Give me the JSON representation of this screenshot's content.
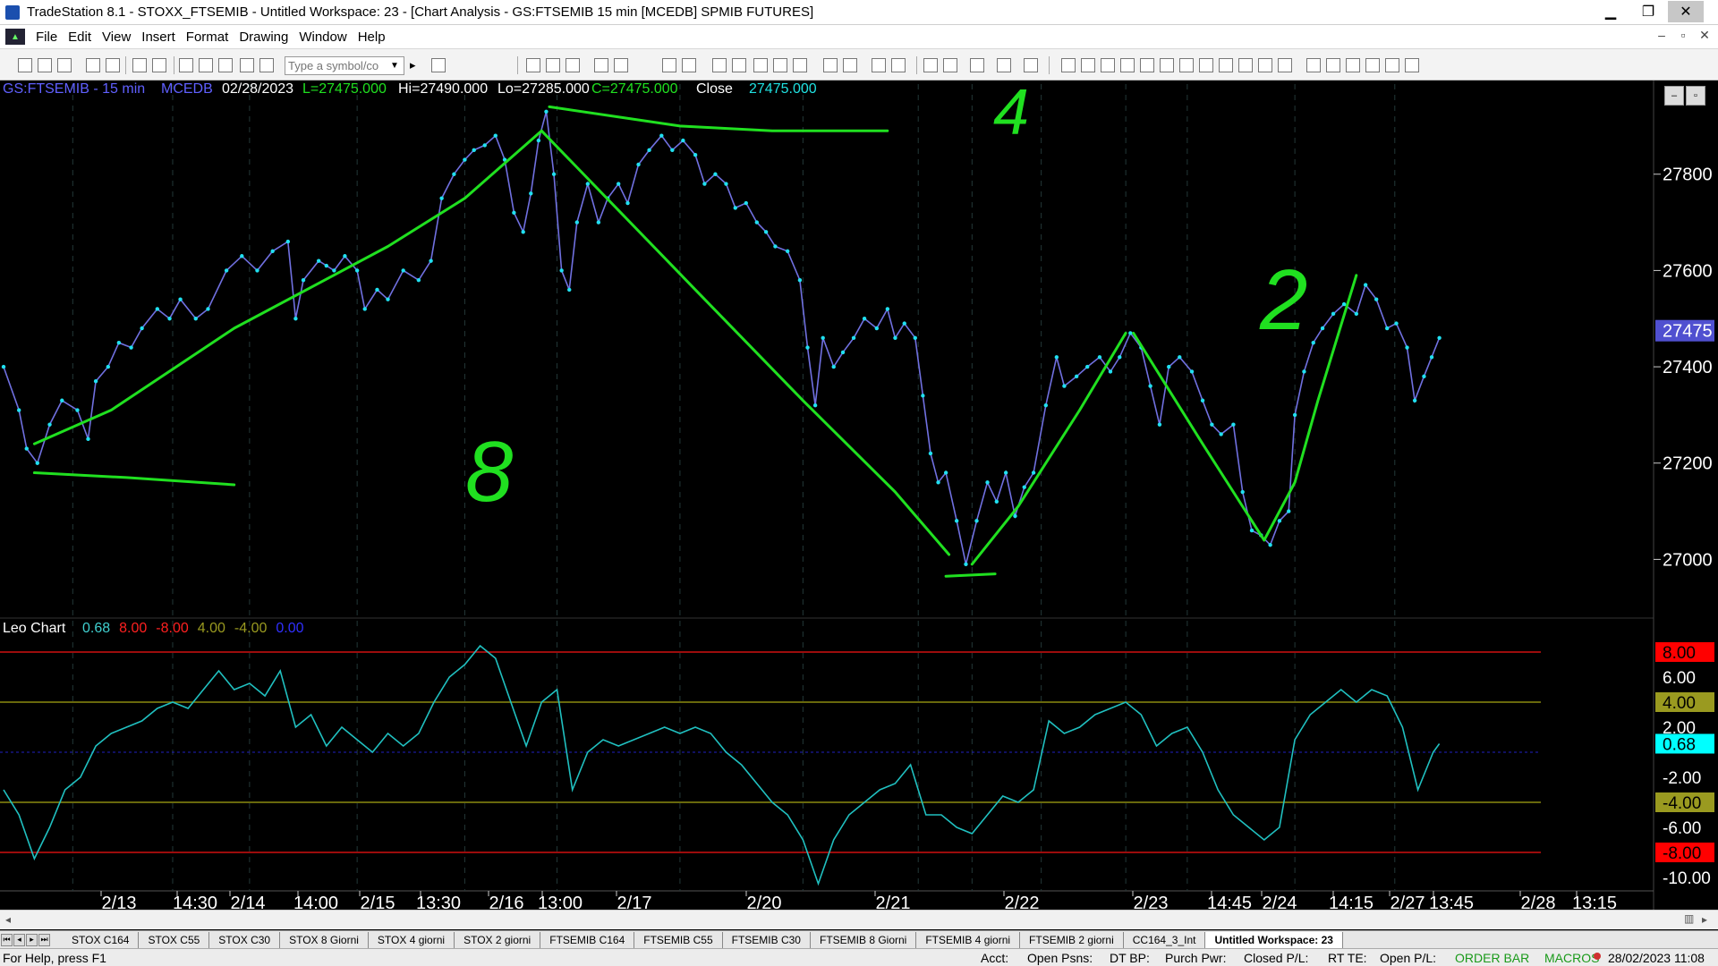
{
  "window": {
    "title": "TradeStation 8.1 - STOXX_FTSEMIB - Untitled Workspace:  23 - [Chart Analysis - GS:FTSEMIB  15 min  [MCEDB] SPMIB FUTURES]",
    "minimize": "▁",
    "restore": "❐",
    "close": "✕"
  },
  "menu": {
    "items": [
      "File",
      "Edit",
      "View",
      "Insert",
      "Format",
      "Drawing",
      "Window",
      "Help"
    ],
    "mdi_min": "–",
    "mdi_restore": "▫",
    "mdi_close": "✕"
  },
  "toolbar": {
    "symbol_placeholder": "Type a symbol/co",
    "dropdown": "▼",
    "arrow": "▸"
  },
  "chart_header": {
    "symbol": "GS:FTSEMIB - 15 min",
    "source": "MCEDB",
    "date": "02/28/2023",
    "last": "L=27475.000",
    "high": "Hi=27490.000",
    "low": "Lo=27285.000",
    "close": "C=27475.000",
    "close_label": "Close",
    "close_value": "27475.000"
  },
  "indicator_header": {
    "name": "Leo Chart",
    "values": [
      {
        "text": "0.68",
        "color": "#40d0d0"
      },
      {
        "text": "8.00",
        "color": "#ff2020"
      },
      {
        "text": "-8.00",
        "color": "#ff2020"
      },
      {
        "text": "4.00",
        "color": "#9a9a20"
      },
      {
        "text": "-4.00",
        "color": "#9a9a20"
      },
      {
        "text": "0.00",
        "color": "#3030ff"
      }
    ]
  },
  "price_axis": {
    "labels": [
      "27800",
      "27600",
      "27400",
      "27200",
      "27000"
    ],
    "current": "27475"
  },
  "indicator_axis": {
    "labels": [
      "8.00",
      "6.00",
      "4.00",
      "2.00",
      "0.68",
      "-2.00",
      "-4.00",
      "-6.00",
      "-8.00",
      "-10.00"
    ],
    "highlight": {
      "8.00": "#ff0000",
      "4.00": "#9a9a20",
      "0.68": "#00ffff",
      "-4.00": "#9a9a20",
      "-8.00": "#ff0000"
    }
  },
  "time_axis": {
    "labels": [
      "2/13",
      "14:30",
      "2/14",
      "14:00",
      "2/15",
      "13:30",
      "2/16",
      "13:00",
      "2/17",
      "2/20",
      "2/21",
      "2/22",
      "2/23",
      "14:45",
      "2/24",
      "14:15",
      "2/27",
      "13:45",
      "2/28",
      "13:15"
    ]
  },
  "annotations": {
    "handwritten": [
      "4",
      "2",
      "8"
    ]
  },
  "chart_data": {
    "type": "line",
    "title": "GS:FTSEMIB - 15 min",
    "ylim": [
      26880,
      27950
    ],
    "x_range": [
      0,
      100
    ],
    "price": [
      [
        0,
        27400
      ],
      [
        1,
        27310
      ],
      [
        1.5,
        27230
      ],
      [
        2.2,
        27200
      ],
      [
        3,
        27280
      ],
      [
        3.8,
        27330
      ],
      [
        4.8,
        27310
      ],
      [
        5.5,
        27250
      ],
      [
        6,
        27370
      ],
      [
        6.8,
        27400
      ],
      [
        7.5,
        27450
      ],
      [
        8.3,
        27440
      ],
      [
        9,
        27480
      ],
      [
        10,
        27520
      ],
      [
        10.8,
        27500
      ],
      [
        11.5,
        27540
      ],
      [
        12.5,
        27500
      ],
      [
        13.3,
        27520
      ],
      [
        14.5,
        27600
      ],
      [
        15.5,
        27630
      ],
      [
        16.5,
        27600
      ],
      [
        17.5,
        27640
      ],
      [
        18.5,
        27660
      ],
      [
        19,
        27500
      ],
      [
        19.5,
        27580
      ],
      [
        20.5,
        27620
      ],
      [
        21,
        27610
      ],
      [
        21.5,
        27600
      ],
      [
        22.2,
        27630
      ],
      [
        23,
        27600
      ],
      [
        23.5,
        27520
      ],
      [
        24.3,
        27560
      ],
      [
        25,
        27540
      ],
      [
        26,
        27600
      ],
      [
        27,
        27580
      ],
      [
        27.8,
        27620
      ],
      [
        28.5,
        27750
      ],
      [
        29.3,
        27800
      ],
      [
        30,
        27830
      ],
      [
        30.6,
        27850
      ],
      [
        31.3,
        27860
      ],
      [
        32,
        27880
      ],
      [
        32.6,
        27830
      ],
      [
        33.2,
        27720
      ],
      [
        33.8,
        27680
      ],
      [
        34.3,
        27760
      ],
      [
        34.8,
        27870
      ],
      [
        35.3,
        27930
      ],
      [
        35.8,
        27800
      ],
      [
        36.3,
        27600
      ],
      [
        36.8,
        27560
      ],
      [
        37.3,
        27700
      ],
      [
        38,
        27780
      ],
      [
        38.7,
        27700
      ],
      [
        39.3,
        27750
      ],
      [
        40,
        27780
      ],
      [
        40.6,
        27740
      ],
      [
        41.3,
        27820
      ],
      [
        42,
        27850
      ],
      [
        42.8,
        27880
      ],
      [
        43.5,
        27850
      ],
      [
        44.2,
        27870
      ],
      [
        45,
        27840
      ],
      [
        45.6,
        27780
      ],
      [
        46.3,
        27800
      ],
      [
        47,
        27780
      ],
      [
        47.6,
        27730
      ],
      [
        48.3,
        27740
      ],
      [
        49,
        27700
      ],
      [
        49.6,
        27680
      ],
      [
        50.2,
        27650
      ],
      [
        51,
        27640
      ],
      [
        51.8,
        27580
      ],
      [
        52.3,
        27440
      ],
      [
        52.8,
        27320
      ],
      [
        53.3,
        27460
      ],
      [
        54,
        27400
      ],
      [
        54.6,
        27430
      ],
      [
        55.3,
        27460
      ],
      [
        56,
        27500
      ],
      [
        56.8,
        27480
      ],
      [
        57.5,
        27520
      ],
      [
        58,
        27460
      ],
      [
        58.6,
        27490
      ],
      [
        59.3,
        27460
      ],
      [
        59.8,
        27340
      ],
      [
        60.3,
        27220
      ],
      [
        60.8,
        27160
      ],
      [
        61.3,
        27180
      ],
      [
        62,
        27080
      ],
      [
        62.6,
        26990
      ],
      [
        63.3,
        27080
      ],
      [
        64,
        27160
      ],
      [
        64.6,
        27120
      ],
      [
        65.2,
        27180
      ],
      [
        65.8,
        27090
      ],
      [
        66.4,
        27150
      ],
      [
        67,
        27180
      ],
      [
        67.8,
        27320
      ],
      [
        68.5,
        27420
      ],
      [
        69,
        27360
      ],
      [
        69.8,
        27380
      ],
      [
        70.5,
        27400
      ],
      [
        71.3,
        27420
      ],
      [
        72,
        27390
      ],
      [
        72.6,
        27420
      ],
      [
        73.3,
        27470
      ],
      [
        74,
        27440
      ],
      [
        74.6,
        27360
      ],
      [
        75.2,
        27280
      ],
      [
        75.8,
        27400
      ],
      [
        76.5,
        27420
      ],
      [
        77.3,
        27390
      ],
      [
        78,
        27330
      ],
      [
        78.6,
        27280
      ],
      [
        79.2,
        27260
      ],
      [
        80,
        27280
      ],
      [
        80.6,
        27140
      ],
      [
        81.2,
        27060
      ],
      [
        81.8,
        27050
      ],
      [
        82.4,
        27030
      ],
      [
        83,
        27080
      ],
      [
        83.6,
        27100
      ],
      [
        84,
        27300
      ],
      [
        84.6,
        27390
      ],
      [
        85.2,
        27450
      ],
      [
        85.8,
        27480
      ],
      [
        86.5,
        27510
      ],
      [
        87.2,
        27530
      ],
      [
        88,
        27510
      ],
      [
        88.6,
        27570
      ],
      [
        89.3,
        27540
      ],
      [
        90,
        27480
      ],
      [
        90.6,
        27490
      ],
      [
        91.3,
        27440
      ],
      [
        91.8,
        27330
      ],
      [
        92.4,
        27380
      ],
      [
        92.9,
        27420
      ],
      [
        93.4,
        27460
      ]
    ],
    "drawn_lines": [
      {
        "name": "trend-up-1",
        "points": [
          [
            2,
            27240
          ],
          [
            7,
            27310
          ],
          [
            15,
            27480
          ],
          [
            25,
            27650
          ],
          [
            30,
            27750
          ],
          [
            35,
            27890
          ]
        ]
      },
      {
        "name": "trend-down-1",
        "points": [
          [
            35,
            27890
          ],
          [
            45,
            27560
          ],
          [
            52,
            27330
          ],
          [
            58,
            27140
          ],
          [
            61.5,
            27010
          ]
        ]
      },
      {
        "name": "trend-up-2",
        "points": [
          [
            63,
            26990
          ],
          [
            66,
            27110
          ],
          [
            70,
            27310
          ],
          [
            73,
            27470
          ]
        ]
      },
      {
        "name": "trend-down-2",
        "points": [
          [
            73.5,
            27470
          ],
          [
            78,
            27240
          ],
          [
            82,
            27040
          ]
        ]
      },
      {
        "name": "trend-up-3",
        "points": [
          [
            82,
            27040
          ],
          [
            84,
            27160
          ],
          [
            85.5,
            27330
          ],
          [
            88,
            27590
          ]
        ]
      },
      {
        "name": "top-line",
        "points": [
          [
            35.5,
            27940
          ],
          [
            44,
            27900
          ],
          [
            50,
            27890
          ],
          [
            57.5,
            27890
          ]
        ]
      },
      {
        "name": "low-line-left",
        "points": [
          [
            2,
            27180
          ],
          [
            8,
            27170
          ],
          [
            15,
            27155
          ]
        ]
      },
      {
        "name": "low-line-right",
        "points": [
          [
            61.3,
            26965
          ],
          [
            64.5,
            26970
          ]
        ]
      }
    ],
    "indicator": {
      "name": "Leo Chart",
      "ylim": [
        -11,
        9.5
      ],
      "levels": [
        8,
        4,
        0,
        -4,
        -8
      ],
      "values": [
        [
          0,
          -3
        ],
        [
          1,
          -5
        ],
        [
          2,
          -8.5
        ],
        [
          3,
          -6
        ],
        [
          4,
          -3
        ],
        [
          5,
          -2
        ],
        [
          6,
          0.5
        ],
        [
          7,
          1.5
        ],
        [
          8,
          2
        ],
        [
          9,
          2.5
        ],
        [
          10,
          3.5
        ],
        [
          11,
          4
        ],
        [
          12,
          3.5
        ],
        [
          13,
          5
        ],
        [
          14,
          6.5
        ],
        [
          15,
          5
        ],
        [
          16,
          5.5
        ],
        [
          17,
          4.5
        ],
        [
          18,
          6.5
        ],
        [
          19,
          2
        ],
        [
          20,
          3
        ],
        [
          21,
          0.5
        ],
        [
          22,
          2
        ],
        [
          23,
          1
        ],
        [
          24,
          0
        ],
        [
          25,
          1.5
        ],
        [
          26,
          0.5
        ],
        [
          27,
          1.5
        ],
        [
          28,
          4
        ],
        [
          29,
          6
        ],
        [
          30,
          7
        ],
        [
          31,
          8.5
        ],
        [
          32,
          7.5
        ],
        [
          33,
          4
        ],
        [
          34,
          0.5
        ],
        [
          35,
          4
        ],
        [
          36,
          5
        ],
        [
          37,
          -3
        ],
        [
          38,
          0
        ],
        [
          39,
          1
        ],
        [
          40,
          0.5
        ],
        [
          41,
          1
        ],
        [
          42,
          1.5
        ],
        [
          43,
          2
        ],
        [
          44,
          1.5
        ],
        [
          45,
          2
        ],
        [
          46,
          1.5
        ],
        [
          47,
          0
        ],
        [
          48,
          -1
        ],
        [
          49,
          -2.5
        ],
        [
          50,
          -4
        ],
        [
          51,
          -5
        ],
        [
          52,
          -7
        ],
        [
          53,
          -10.5
        ],
        [
          54,
          -7
        ],
        [
          55,
          -5
        ],
        [
          56,
          -4
        ],
        [
          57,
          -3
        ],
        [
          58,
          -2.5
        ],
        [
          59,
          -1
        ],
        [
          60,
          -5
        ],
        [
          61,
          -5
        ],
        [
          62,
          -6
        ],
        [
          63,
          -6.5
        ],
        [
          64,
          -5
        ],
        [
          65,
          -3.5
        ],
        [
          66,
          -4
        ],
        [
          67,
          -3
        ],
        [
          68,
          2.5
        ],
        [
          69,
          1.5
        ],
        [
          70,
          2
        ],
        [
          71,
          3
        ],
        [
          72,
          3.5
        ],
        [
          73,
          4
        ],
        [
          74,
          3
        ],
        [
          75,
          0.5
        ],
        [
          76,
          1.5
        ],
        [
          77,
          2
        ],
        [
          78,
          0
        ],
        [
          79,
          -3
        ],
        [
          80,
          -5
        ],
        [
          81,
          -6
        ],
        [
          82,
          -7
        ],
        [
          83,
          -6
        ],
        [
          84,
          1
        ],
        [
          85,
          3
        ],
        [
          86,
          4
        ],
        [
          87,
          5
        ],
        [
          88,
          4
        ],
        [
          89,
          5
        ],
        [
          90,
          4.5
        ],
        [
          91,
          2
        ],
        [
          92,
          -3
        ],
        [
          93,
          0
        ],
        [
          93.4,
          0.68
        ]
      ]
    },
    "colors": {
      "price_line": "#7070e0",
      "price_dots": "#20e0f0",
      "drawn_lines": "#20e020",
      "indicator_line": "#20c0c0"
    }
  },
  "sheet_tabs": [
    "STOX C164",
    "STOX C55",
    "STOX  C30",
    "STOX  8 Giorni",
    "STOX 4 giorni",
    "STOX  2 giorni",
    "FTSEMIB C164",
    "FTSEMIB C55",
    "FTSEMIB C30",
    "FTSEMIB  8 Giorni",
    "FTSEMIB  4 giorni",
    "FTSEMIB  2 giorni",
    "CC164_3_Int",
    "Untitled Workspace:  23"
  ],
  "status": {
    "help": "For Help, press F1",
    "acct": "Acct:",
    "open_psns": "Open Psns:",
    "dt_bp": "DT BP:",
    "purch_pwr": "Purch Pwr:",
    "closed_pl": "Closed P/L:",
    "rt_te": "RT TE:",
    "open_pl": "Open P/L:",
    "order_bar": "ORDER BAR",
    "macros": "MACROS",
    "datetime": "28/02/2023 11:08"
  }
}
